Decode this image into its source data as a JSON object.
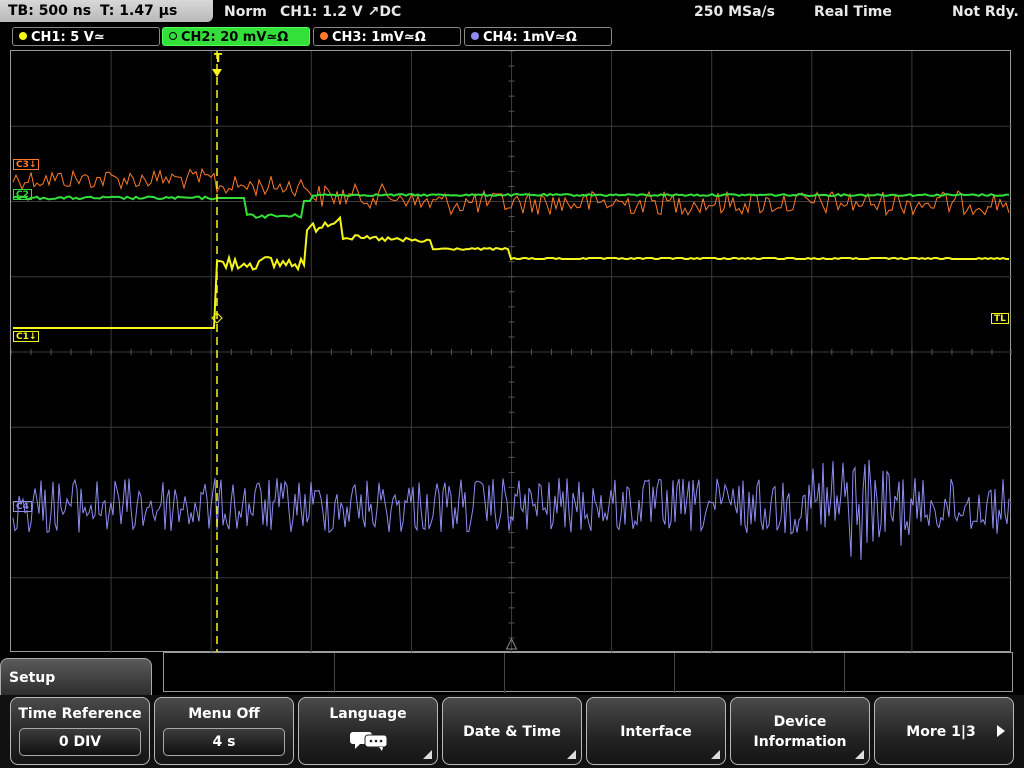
{
  "header": {
    "timebase": "TB: 500 ns",
    "trigger_time": "T: 1.47 μs",
    "trigger_mode": "Norm",
    "trigger_source": "CH1: 1.2 V ↗DC",
    "sample_rate": "250 MSa/s",
    "acq_mode": "Real Time",
    "status": "Not Rdy."
  },
  "channels": [
    {
      "label": "CH1: 5 V≃",
      "color": "#f5f51e"
    },
    {
      "label": "CH2: 20 mV≃Ω",
      "color": "#33e03a",
      "active": true
    },
    {
      "label": "CH3: 1mV≃Ω",
      "color": "#ff7a2a"
    },
    {
      "label": "CH4: 1mV≃Ω",
      "color": "#8c8cf0"
    }
  ],
  "markers": {
    "c3": "C3↓",
    "c1": "C1↓",
    "c2": "C2",
    "c4": "C4",
    "tl": "TL",
    "t": "T"
  },
  "menu": {
    "title": "Setup",
    "buttons": [
      {
        "label": "Time Reference",
        "value": "0 DIV"
      },
      {
        "label": "Menu Off",
        "value": "4 s"
      },
      {
        "label": "Language",
        "icon": "speech-bubble-icon"
      },
      {
        "label": "Date & Time"
      },
      {
        "label": "Interface"
      },
      {
        "label": "Device Information"
      },
      {
        "label": "More 1|3"
      }
    ]
  },
  "colors": {
    "ch1": "#f5f51e",
    "ch2": "#33e03a",
    "ch3": "#ff7a2a",
    "ch4": "#8c8cf0",
    "grid": "#3a3a3a",
    "trigger": "#f5f51e"
  }
}
